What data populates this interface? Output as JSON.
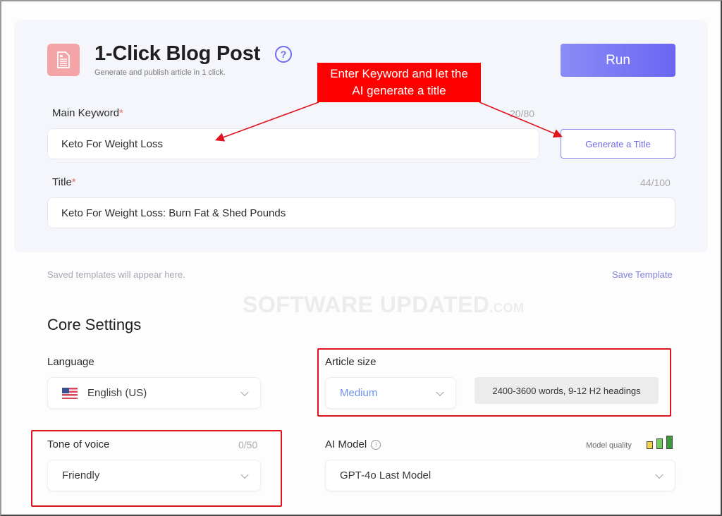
{
  "header": {
    "title": "1-Click Blog Post",
    "subtitle": "Generate and publish article in 1 click.",
    "run_label": "Run",
    "app_icon": "document-icon",
    "help_icon": "question-circle-icon",
    "help_glyph": "?"
  },
  "main_keyword": {
    "label": "Main Keyword",
    "required_mark": "*",
    "counter": "20/80",
    "value": "Keto For Weight Loss",
    "generate_label": "Generate a Title"
  },
  "title_field": {
    "label": "Title",
    "required_mark": "*",
    "counter": "44/100",
    "value": "Keto For Weight Loss: Burn Fat & Shed Pounds"
  },
  "templates": {
    "empty_note": "Saved templates will appear here.",
    "save_label": "Save Template"
  },
  "watermark": {
    "main": "SOFTWARE UPDATED",
    "suffix": ".COM"
  },
  "core_settings": {
    "title": "Core Settings",
    "language": {
      "label": "Language",
      "value": "English (US)",
      "flag_icon": "us-flag-icon"
    },
    "article_size": {
      "label": "Article size",
      "value": "Medium",
      "info": "2400-3600 words, 9-12 H2 headings"
    },
    "tone": {
      "label": "Tone of voice",
      "counter": "0/50",
      "value": "Friendly"
    },
    "ai_model": {
      "label": "AI Model",
      "info_glyph": "!",
      "quality_label": "Model quality",
      "quality_level": 3,
      "quality_max": 3,
      "value": "GPT-4o Last Model"
    }
  },
  "annotation": {
    "callout_line1": "Enter Keyword and let the",
    "callout_line2": "AI generate a title"
  },
  "colors": {
    "accent": "#6f6cf2",
    "callout": "#ff0000",
    "required": "#e56d6d",
    "quality_low": "#f2d44a",
    "quality_mid": "#6fcf5a",
    "quality_high": "#3d9a3a"
  }
}
